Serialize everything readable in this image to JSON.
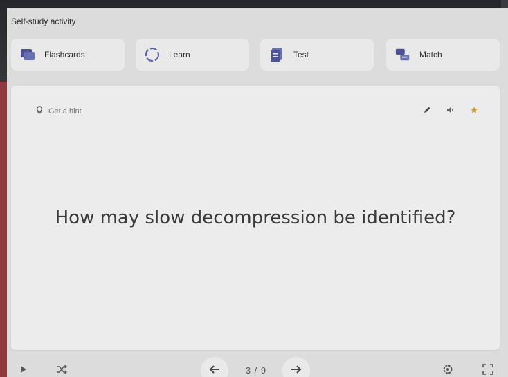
{
  "panel": {
    "title": "Self-study activity"
  },
  "modes": [
    {
      "label": "Flashcards",
      "icon": "flashcards-icon"
    },
    {
      "label": "Learn",
      "icon": "learn-icon"
    },
    {
      "label": "Test",
      "icon": "test-icon"
    },
    {
      "label": "Match",
      "icon": "match-icon"
    }
  ],
  "card": {
    "hint_label": "Get a hint",
    "question": "How may slow decompression be identified?",
    "star_color": "#c9a227"
  },
  "navigation": {
    "counter": "3 / 9"
  },
  "colors": {
    "accent": "#5b63a8",
    "panel_bg": "#dcdcdc",
    "card_bg": "#ececec",
    "side_strip": "#8e3a3e"
  }
}
